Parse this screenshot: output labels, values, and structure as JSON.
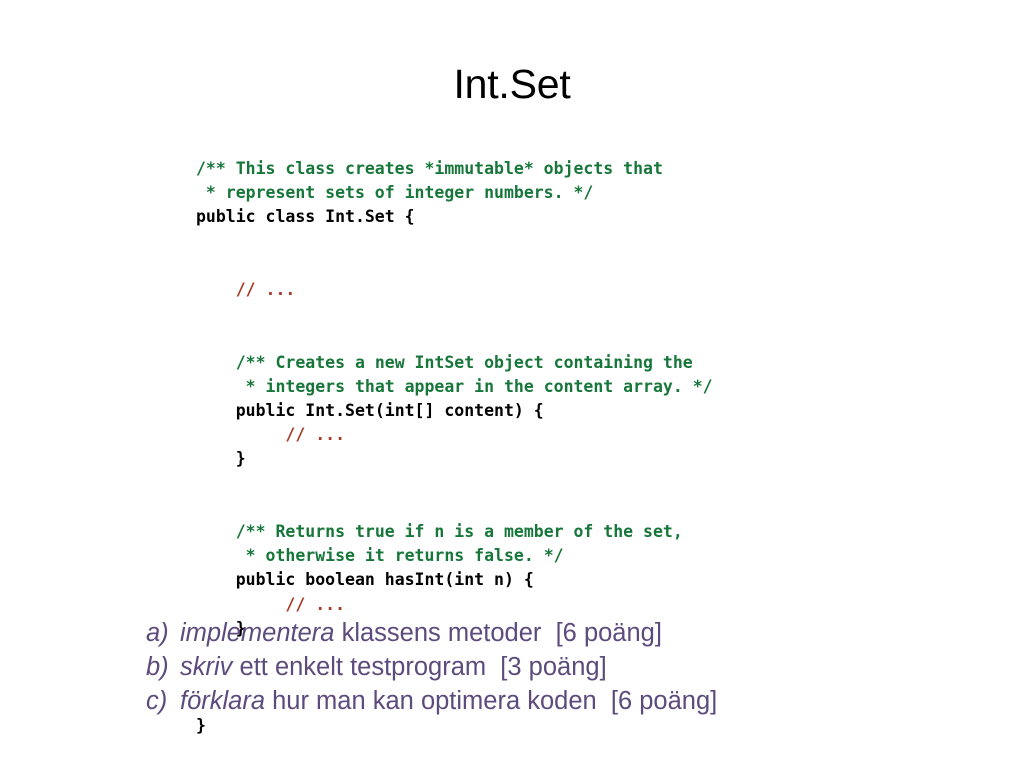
{
  "slide": {
    "title": "Int.Set",
    "background_color": "#ffffff"
  },
  "colors": {
    "title": "#000000",
    "comment_green": "#17763a",
    "ellipsis_red": "#a83a26",
    "code_black": "#000000",
    "task_purple": "#5d4b7d"
  },
  "code": {
    "language": "java",
    "lines": [
      {
        "indent": 0,
        "segments": [
          {
            "text": "/** This class creates *immutable* objects that",
            "style": "comment"
          }
        ]
      },
      {
        "indent": 0,
        "segments": [
          {
            "text": " * represent sets of integer numbers. */",
            "style": "comment"
          }
        ]
      },
      {
        "indent": 0,
        "segments": [
          {
            "text": "public class Int.Set {",
            "style": "code"
          }
        ]
      },
      {
        "indent": 0,
        "segments": []
      },
      {
        "indent": 0,
        "segments": []
      },
      {
        "indent": 4,
        "segments": [
          {
            "text": "// ...",
            "style": "slash"
          }
        ]
      },
      {
        "indent": 0,
        "segments": []
      },
      {
        "indent": 0,
        "segments": []
      },
      {
        "indent": 4,
        "segments": [
          {
            "text": "/** Creates a new IntSet object containing the",
            "style": "comment"
          }
        ]
      },
      {
        "indent": 4,
        "segments": [
          {
            "text": " * integers that appear in the content array. */",
            "style": "comment"
          }
        ]
      },
      {
        "indent": 4,
        "segments": [
          {
            "text": "public Int.Set(int[] content) {",
            "style": "code"
          }
        ]
      },
      {
        "indent": 9,
        "segments": [
          {
            "text": "// ...",
            "style": "slash"
          }
        ]
      },
      {
        "indent": 4,
        "segments": [
          {
            "text": "}",
            "style": "code"
          }
        ]
      },
      {
        "indent": 0,
        "segments": []
      },
      {
        "indent": 0,
        "segments": []
      },
      {
        "indent": 4,
        "segments": [
          {
            "text": "/** Returns true if n is a member of the set,",
            "style": "comment"
          }
        ]
      },
      {
        "indent": 4,
        "segments": [
          {
            "text": " * otherwise it returns false. */",
            "style": "comment"
          }
        ]
      },
      {
        "indent": 4,
        "segments": [
          {
            "text": "public boolean hasInt(int n) {",
            "style": "code"
          }
        ]
      },
      {
        "indent": 9,
        "segments": [
          {
            "text": "// ...",
            "style": "slash"
          }
        ]
      },
      {
        "indent": 4,
        "segments": [
          {
            "text": "}",
            "style": "code"
          }
        ]
      },
      {
        "indent": 0,
        "segments": []
      },
      {
        "indent": 0,
        "segments": []
      },
      {
        "indent": 0,
        "segments": []
      },
      {
        "indent": 0,
        "segments": [
          {
            "text": "}",
            "style": "code"
          }
        ]
      }
    ]
  },
  "tasks": [
    {
      "marker": "a)",
      "emphasis": "implementera",
      "rest": " klassens metoder",
      "points": "  [6 poäng]"
    },
    {
      "marker": "b)",
      "emphasis": "skriv",
      "rest": " ett enkelt testprogram",
      "points": "  [3 poäng]"
    },
    {
      "marker": "c)",
      "emphasis": "förklara",
      "rest": " hur man kan optimera koden",
      "points": "  [6 poäng]"
    }
  ]
}
